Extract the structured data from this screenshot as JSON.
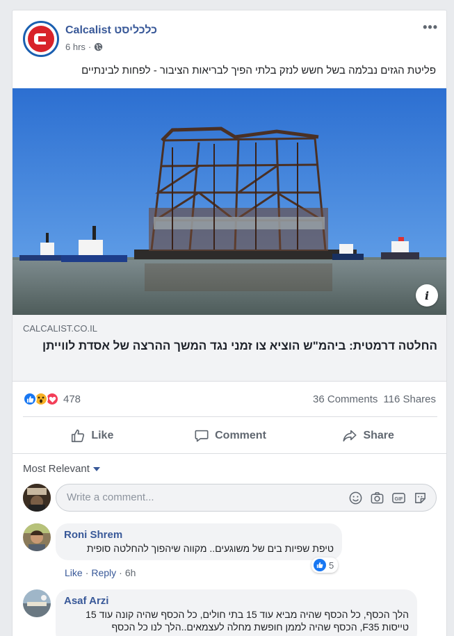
{
  "post": {
    "page_name": "Calcalist כלכליסט",
    "time": "6 hrs",
    "separator": "·",
    "text": "פליטת הגזים נבלמה בשל חשש לנזק בלתי הפיך לבריאות הציבור - לפחות לבינתיים",
    "more_label": "•••"
  },
  "link": {
    "domain": "CALCALIST.CO.IL",
    "title": "החלטה דרמטית: ביהמ\"ש הוציא צו זמני נגד המשך ההרצה של אסדת לווייתן",
    "info_label": "i"
  },
  "stats": {
    "reaction_count": "478",
    "comments": "36 Comments",
    "shares": "116 Shares"
  },
  "actions": {
    "like": "Like",
    "comment": "Comment",
    "share": "Share"
  },
  "comments_section": {
    "sort_label": "Most Relevant",
    "input_placeholder": "Write a comment...",
    "items": [
      {
        "author": "Roni Shrem",
        "text": "טיפת שפיות בים של משוגעים.. מקווה שיהפוך להחלטה סופית",
        "like": "Like",
        "reply": "Reply",
        "time": "6h",
        "reaction_count": "5"
      },
      {
        "author": "Asaf Arzi",
        "text": "הלך הכסף, כל הכסף שהיה מביא עוד 15 בתי חולים, כל הכסף שהיה קונה עוד 15 טייסות F35, הכסף שהיה לממן חופשת מחלה לעצמאים..הלך לנו כל הכסף"
      }
    ]
  },
  "colors": {
    "brand_link": "#385898",
    "like_blue": "#1877f2",
    "love_red": "#f33e58",
    "wow_yellow": "#f7b125",
    "logo_red": "#d8232a",
    "logo_blue": "#1a5fb0"
  }
}
